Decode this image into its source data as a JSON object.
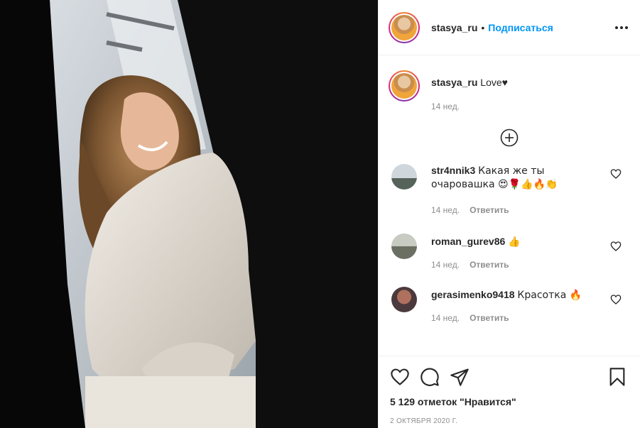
{
  "post": {
    "username": "stasya_ru",
    "follow_label": "Подписаться",
    "separator": "•",
    "caption_text": "Love♥",
    "caption_time": "14 нед.",
    "likes_label": "5 129 отметок \"Нравится\"",
    "date_label": "2 ОКТЯБРЯ 2020 Г."
  },
  "comments": [
    {
      "user": "str4nnik3",
      "text": "Какая же ты очаровашка 😍🌹👍🔥👏",
      "time": "14 нед.",
      "reply": "Ответить"
    },
    {
      "user": "roman_gurev86",
      "text": "👍",
      "time": "14 нед.",
      "reply": "Ответить"
    },
    {
      "user": "gerasimenko9418",
      "text": "Красотка 🔥",
      "time": "14 нед.",
      "reply": "Ответить"
    }
  ],
  "colors": {
    "link_blue": "#0095f6",
    "text": "#262626",
    "muted": "#8e8e8e",
    "divider": "#efefef"
  },
  "icons": [
    "more-horizontal-icon",
    "load-more-plus-icon",
    "heart-icon",
    "comment-icon",
    "share-icon",
    "bookmark-icon"
  ]
}
